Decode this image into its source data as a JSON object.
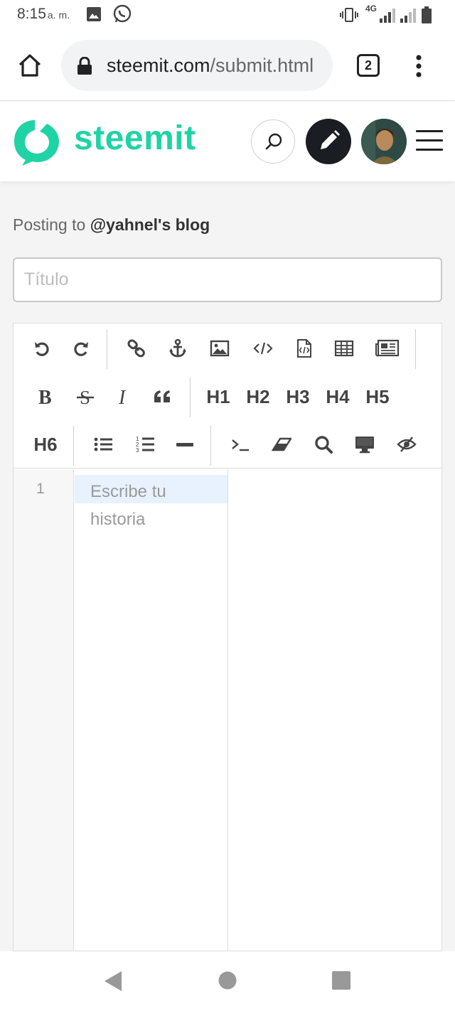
{
  "status_bar": {
    "time": "8:15",
    "ampm": "a. m.",
    "network": "4G",
    "icons": [
      "gallery-icon",
      "whatsapp-icon",
      "vibrate-icon",
      "signal-icon",
      "signal-icon",
      "battery-icon"
    ]
  },
  "browser": {
    "url_host": "steemit.com",
    "url_path": "/submit.html",
    "tab_count": "2"
  },
  "header": {
    "brand": "steemit",
    "brand_color": "#1fd3a5"
  },
  "posting": {
    "prefix": "Posting to ",
    "blog": "@yahnel's blog"
  },
  "title_field": {
    "placeholder": "Título",
    "value": ""
  },
  "toolbar": {
    "heading_labels": [
      "H1",
      "H2",
      "H3",
      "H4",
      "H5",
      "H6"
    ],
    "icons": [
      "undo-icon",
      "redo-icon",
      "link-icon",
      "anchor-icon",
      "image-icon",
      "code-icon",
      "code-file-icon",
      "table-icon",
      "newspaper-icon",
      "bold-icon",
      "strikethrough-icon",
      "italic-icon",
      "quote-icon",
      "unordered-list-icon",
      "ordered-list-icon",
      "horizontal-rule-icon",
      "terminal-icon",
      "eraser-icon",
      "search-icon",
      "monitor-icon",
      "eye-slash-icon"
    ]
  },
  "editor": {
    "line_number": "1",
    "placeholder": "Escribe tu historia"
  }
}
